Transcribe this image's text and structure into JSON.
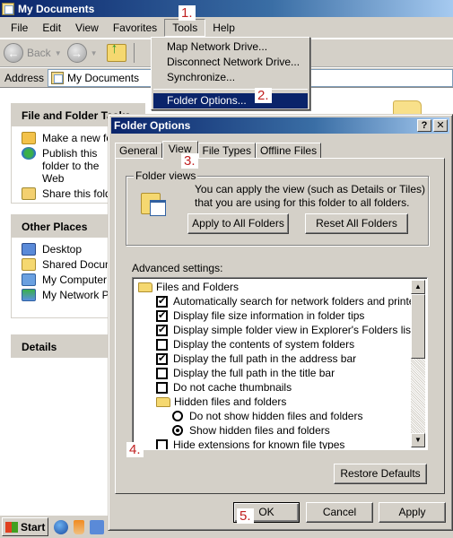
{
  "window": {
    "title": "My Documents"
  },
  "menubar": {
    "items": [
      "File",
      "Edit",
      "View",
      "Favorites",
      "Tools",
      "Help"
    ],
    "active": "Tools"
  },
  "toolbar": {
    "back_label": "Back"
  },
  "address": {
    "label": "Address",
    "value": "My Documents"
  },
  "tools_menu": {
    "items": [
      "Map Network Drive...",
      "Disconnect Network Drive...",
      "Synchronize...",
      "Folder Options..."
    ],
    "highlighted": "Folder Options..."
  },
  "left_pane": {
    "file_tasks": {
      "title": "File and Folder Tasks",
      "items": [
        "Make a new folder",
        "Publish this folder to the Web",
        "Share this folder"
      ]
    },
    "other_places": {
      "title": "Other Places",
      "items": [
        "Desktop",
        "Shared Documents",
        "My Computer",
        "My Network Places"
      ]
    },
    "details": {
      "title": "Details"
    }
  },
  "annotations": [
    "1.",
    "2.",
    "3.",
    "4.",
    "5."
  ],
  "dialog": {
    "title": "Folder Options",
    "help_button": "?",
    "close_button": "✕",
    "tabs": [
      "General",
      "View",
      "File Types",
      "Offline Files"
    ],
    "active_tab": "View",
    "folder_views": {
      "label": "Folder views",
      "description": "You can apply the view (such as Details or Tiles) that you are using for this folder to all folders.",
      "apply_all": "Apply to All Folders",
      "reset_all": "Reset All Folders"
    },
    "advanced": {
      "label": "Advanced settings:",
      "items": [
        {
          "type": "folder",
          "label": "Files and Folders",
          "level": 0
        },
        {
          "type": "checkbox",
          "label": "Automatically search for network folders and printers",
          "checked": true,
          "level": 1
        },
        {
          "type": "checkbox",
          "label": "Display file size information in folder tips",
          "checked": true,
          "level": 1
        },
        {
          "type": "checkbox",
          "label": "Display simple folder view in Explorer's Folders list",
          "checked": true,
          "level": 1
        },
        {
          "type": "checkbox",
          "label": "Display the contents of system folders",
          "checked": false,
          "level": 1
        },
        {
          "type": "checkbox",
          "label": "Display the full path in the address bar",
          "checked": true,
          "level": 1
        },
        {
          "type": "checkbox",
          "label": "Display the full path in the title bar",
          "checked": false,
          "level": 1
        },
        {
          "type": "checkbox",
          "label": "Do not cache thumbnails",
          "checked": false,
          "level": 1
        },
        {
          "type": "folder",
          "label": "Hidden files and folders",
          "level": 1
        },
        {
          "type": "radio",
          "label": "Do not show hidden files and folders",
          "checked": false,
          "level": 2
        },
        {
          "type": "radio",
          "label": "Show hidden files and folders",
          "checked": true,
          "level": 2
        },
        {
          "type": "checkbox",
          "label": "Hide extensions for known file types",
          "checked": false,
          "level": 1
        }
      ]
    },
    "restore_defaults": "Restore Defaults",
    "ok": "OK",
    "cancel": "Cancel",
    "apply": "Apply"
  },
  "taskbar": {
    "start_label": "Start"
  }
}
